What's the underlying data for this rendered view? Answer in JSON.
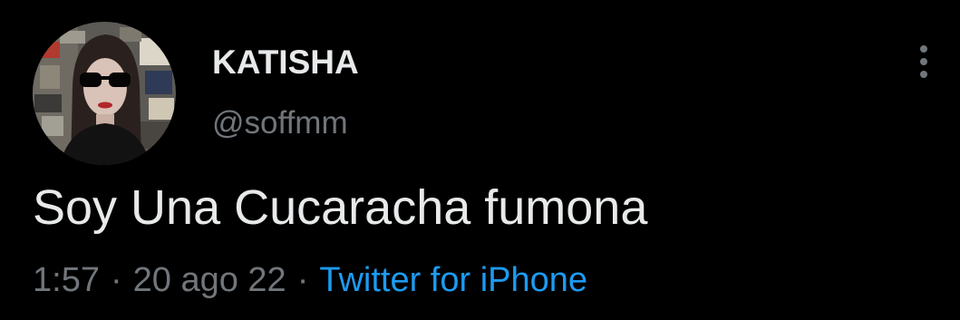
{
  "tweet": {
    "author": {
      "display_name": "KATISHA",
      "handle": "@soffmm",
      "avatar_icon": "profile-avatar"
    },
    "text": "Soy Una Cucaracha fumona",
    "meta": {
      "time": "1:57",
      "separator": "·",
      "date": "20 ago 22",
      "source": "Twitter for iPhone"
    },
    "more_icon": "more-options-icon"
  },
  "colors": {
    "background": "#000000",
    "primary_text": "#e7e9ea",
    "secondary_text": "#71767b",
    "link": "#1d9bf0"
  }
}
